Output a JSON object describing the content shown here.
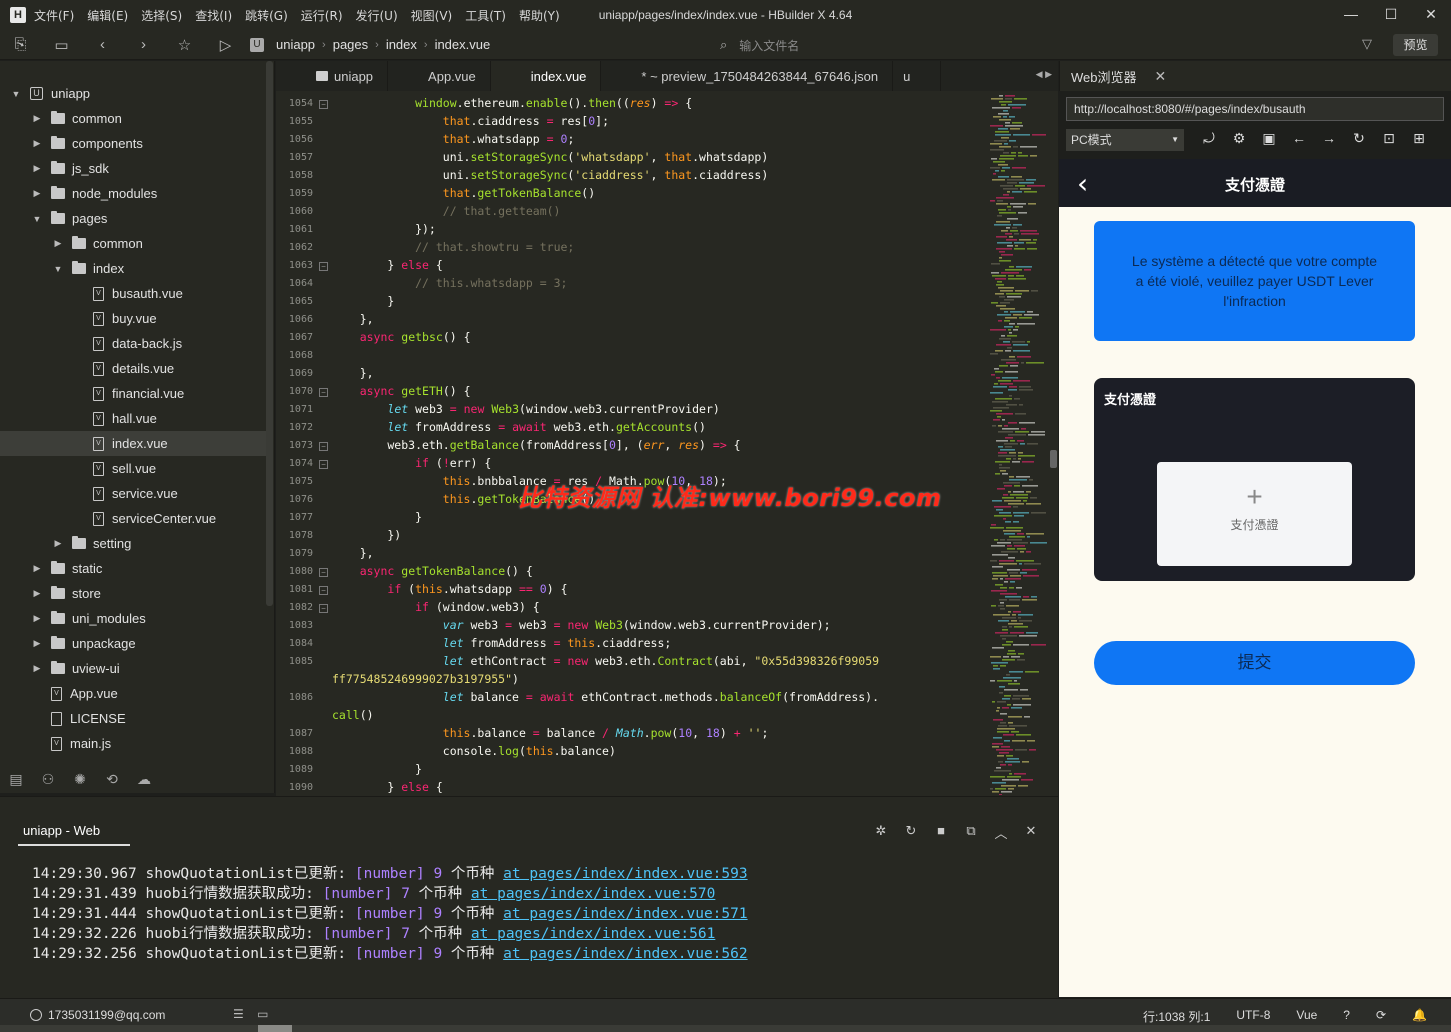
{
  "window": {
    "title": "uniapp/pages/index/index.vue - HBuilder X 4.64",
    "logo": "H",
    "menu": [
      "文件(F)",
      "编辑(E)",
      "选择(S)",
      "查找(I)",
      "跳转(G)",
      "运行(R)",
      "发行(U)",
      "视图(V)",
      "工具(T)",
      "帮助(Y)"
    ]
  },
  "toolbar": {
    "breadcrumb": [
      "uniapp",
      "pages",
      "index",
      "index.vue"
    ],
    "search_placeholder": "输入文件名",
    "preview_label": "预览"
  },
  "sidebar": {
    "items": [
      {
        "label": "uniapp",
        "depth": 0,
        "kind": "project",
        "open": true
      },
      {
        "label": "common",
        "depth": 1,
        "kind": "folder"
      },
      {
        "label": "components",
        "depth": 1,
        "kind": "folder"
      },
      {
        "label": "js_sdk",
        "depth": 1,
        "kind": "folder"
      },
      {
        "label": "node_modules",
        "depth": 1,
        "kind": "folder"
      },
      {
        "label": "pages",
        "depth": 1,
        "kind": "folder",
        "open": true
      },
      {
        "label": "common",
        "depth": 2,
        "kind": "folder"
      },
      {
        "label": "index",
        "depth": 2,
        "kind": "folder",
        "open": true
      },
      {
        "label": "busauth.vue",
        "depth": 3,
        "kind": "file"
      },
      {
        "label": "buy.vue",
        "depth": 3,
        "kind": "file"
      },
      {
        "label": "data-back.js",
        "depth": 3,
        "kind": "file"
      },
      {
        "label": "details.vue",
        "depth": 3,
        "kind": "file"
      },
      {
        "label": "financial.vue",
        "depth": 3,
        "kind": "file"
      },
      {
        "label": "hall.vue",
        "depth": 3,
        "kind": "file"
      },
      {
        "label": "index.vue",
        "depth": 3,
        "kind": "file",
        "selected": true
      },
      {
        "label": "sell.vue",
        "depth": 3,
        "kind": "file"
      },
      {
        "label": "service.vue",
        "depth": 3,
        "kind": "file"
      },
      {
        "label": "serviceCenter.vue",
        "depth": 3,
        "kind": "file"
      },
      {
        "label": "setting",
        "depth": 2,
        "kind": "folder"
      },
      {
        "label": "static",
        "depth": 1,
        "kind": "folder"
      },
      {
        "label": "store",
        "depth": 1,
        "kind": "folder"
      },
      {
        "label": "uni_modules",
        "depth": 1,
        "kind": "folder"
      },
      {
        "label": "unpackage",
        "depth": 1,
        "kind": "folder"
      },
      {
        "label": "uview-ui",
        "depth": 1,
        "kind": "folder"
      },
      {
        "label": "App.vue",
        "depth": 1,
        "kind": "file"
      },
      {
        "label": "LICENSE",
        "depth": 1,
        "kind": "plain"
      },
      {
        "label": "main.js",
        "depth": 1,
        "kind": "file"
      }
    ]
  },
  "tabs": [
    {
      "label": "uniapp",
      "folder": true
    },
    {
      "label": "App.vue"
    },
    {
      "label": "index.vue",
      "active": true
    },
    {
      "label": "* ~ preview_1750484263844_67646.json"
    },
    {
      "label": "u"
    }
  ],
  "editor": {
    "lines": [
      {
        "n": "1054",
        "html": "            <span class='fn'>window</span>.ethereum.<span class='fn'>enable</span>().<span class='fn'>then</span>((<span class='pr'>res</span>) <span class='kw'>=&gt;</span> {"
      },
      {
        "n": "1055",
        "html": "                <span class='th'>that</span>.ciaddress <span class='kw'>=</span> res[<span class='num'>0</span>];"
      },
      {
        "n": "1056",
        "html": "                <span class='th'>that</span>.whatsdapp <span class='kw'>=</span> <span class='num'>0</span>;"
      },
      {
        "n": "1057",
        "html": "                uni.<span class='fn'>setStorageSync</span>(<span class='str'>'whatsdapp'</span>, <span class='th'>that</span>.whatsdapp)"
      },
      {
        "n": "1058",
        "html": "                uni.<span class='fn'>setStorageSync</span>(<span class='str'>'ciaddress'</span>, <span class='th'>that</span>.ciaddress)"
      },
      {
        "n": "1059",
        "html": "                <span class='th'>that</span>.<span class='fn'>getTokenBalance</span>()"
      },
      {
        "n": "1060",
        "html": "                <span class='cm'>// that.getteam()</span>"
      },
      {
        "n": "1061",
        "html": "            });"
      },
      {
        "n": "1062",
        "html": "            <span class='cm'>// that.showtru = true;</span>"
      },
      {
        "n": "1063",
        "html": "        } <span class='kw'>else</span> {"
      },
      {
        "n": "1064",
        "html": "            <span class='cm'>// this.whatsdapp = 3;</span>"
      },
      {
        "n": "1065",
        "html": "        }"
      },
      {
        "n": "1066",
        "html": "    },"
      },
      {
        "n": "1067",
        "html": "    <span class='kw'>async</span> <span class='fn'>getbsc</span>() {"
      },
      {
        "n": "1068",
        "html": ""
      },
      {
        "n": "1069",
        "html": "    },"
      },
      {
        "n": "1070",
        "html": "    <span class='kw'>async</span> <span class='fn'>getETH</span>() {"
      },
      {
        "n": "1071",
        "html": "        <span class='pl'>let</span> web3 <span class='kw'>=</span> <span class='kw'>new</span> <span class='fn'>Web3</span>(window.web3.currentProvider)"
      },
      {
        "n": "1072",
        "html": "        <span class='pl'>let</span> fromAddress <span class='kw'>=</span> <span class='kw'>await</span> web3.eth.<span class='fn'>getAccounts</span>()"
      },
      {
        "n": "1073",
        "html": "        web3.eth.<span class='fn'>getBalance</span>(fromAddress[<span class='num'>0</span>], (<span class='pr'>err</span>, <span class='pr'>res</span>) <span class='kw'>=&gt;</span> {"
      },
      {
        "n": "1074",
        "html": "            <span class='kw'>if</span> (<span class='kw'>!</span>err) {"
      },
      {
        "n": "1075",
        "html": "                <span class='th'>this</span>.bnbbalance <span class='kw'>=</span> res <span class='kw'>/</span> Math.<span class='fn'>pow</span>(<span class='num'>10</span>, <span class='num'>18</span>);"
      },
      {
        "n": "1076",
        "html": "                <span class='th'>this</span>.<span class='fn'>getTokenBalance</span>()"
      },
      {
        "n": "1077",
        "html": "            }"
      },
      {
        "n": "1078",
        "html": "        })"
      },
      {
        "n": "1079",
        "html": "    },"
      },
      {
        "n": "1080",
        "html": "    <span class='kw'>async</span> <span class='fn'>getTokenBalance</span>() {"
      },
      {
        "n": "1081",
        "html": "        <span class='kw'>if</span> (<span class='th'>this</span>.whatsdapp <span class='kw'>==</span> <span class='num'>0</span>) {"
      },
      {
        "n": "1082",
        "html": "            <span class='kw'>if</span> (window.web3) {"
      },
      {
        "n": "1083",
        "html": "                <span class='pl'>var</span> web3 <span class='kw'>=</span> web3 <span class='kw'>=</span> <span class='kw'>new</span> <span class='fn'>Web3</span>(window.web3.currentProvider);"
      },
      {
        "n": "1084",
        "html": "                <span class='pl'>let</span> fromAddress <span class='kw'>=</span> <span class='th'>this</span>.ciaddress;"
      },
      {
        "n": "1085",
        "html": "                <span class='pl'>let</span> ethContract <span class='kw'>=</span> <span class='kw'>new</span> web3.eth.<span class='fn'>Contract</span>(abi, <span class='str'>\"0x55d398326f99059</span>"
      },
      {
        "n": "",
        "html": "<span class='str'>ff775485246999027b3197955\"</span>)",
        "wrap": true
      },
      {
        "n": "1086",
        "html": "                <span class='pl'>let</span> balance <span class='kw'>=</span> <span class='kw'>await</span> ethContract.methods.<span class='fn'>balanceOf</span>(fromAddress)."
      },
      {
        "n": "",
        "html": "<span class='fn'>call</span>()",
        "wrap": true
      },
      {
        "n": "1087",
        "html": "                <span class='th'>this</span>.balance <span class='kw'>=</span> balance <span class='kw'>/</span> <span class='pl'>Math</span>.<span class='fn'>pow</span>(<span class='num'>10</span>, <span class='num'>18</span>) <span class='kw'>+</span> <span class='str'>''</span>;"
      },
      {
        "n": "1088",
        "html": "                console.<span class='fn'>log</span>(<span class='th'>this</span>.balance)"
      },
      {
        "n": "1089",
        "html": "            }"
      },
      {
        "n": "1090",
        "html": "        } <span class='kw'>else</span> {"
      }
    ],
    "folds": [
      "1054",
      "1063",
      "1070",
      "1073",
      "1074",
      "1080",
      "1081",
      "1082"
    ],
    "watermark": "比特资源网 认准:www.bori99.com"
  },
  "web_panel": {
    "tab_label": "Web浏览器",
    "url": "http://localhost:8080/#/pages/index/busauth",
    "mode": "PC模式",
    "page": {
      "nav_title": "支付憑證",
      "alert_text": "Le système a détecté que votre compte a été violé, veuillez payer USDT Lever l'infraction",
      "card_title": "支付憑證",
      "upload_label": "支付憑證",
      "submit_label": "提交"
    }
  },
  "console": {
    "tab_label": "uniapp - Web",
    "logs": [
      {
        "time": "14:29:30.967",
        "msg": "showQuotationList已更新:",
        "type": "[number]",
        "count": "9",
        "unit": "个币种",
        "link": "at pages/index/index.vue:593"
      },
      {
        "time": "14:29:31.439",
        "msg": "huobi行情数据获取成功:",
        "type": "[number]",
        "count": "7",
        "unit": "个币种",
        "link": "at pages/index/index.vue:570"
      },
      {
        "time": "14:29:31.444",
        "msg": "showQuotationList已更新:",
        "type": "[number]",
        "count": "9",
        "unit": "个币种",
        "link": "at pages/index/index.vue:571"
      },
      {
        "time": "14:29:32.226",
        "msg": "huobi行情数据获取成功:",
        "type": "[number]",
        "count": "7",
        "unit": "个币种",
        "link": "at pages/index/index.vue:561"
      },
      {
        "time": "14:29:32.256",
        "msg": "showQuotationList已更新:",
        "type": "[number]",
        "count": "9",
        "unit": "个币种",
        "link": "at pages/index/index.vue:562"
      }
    ]
  },
  "status": {
    "user": "1735031199@qq.com",
    "position": "行:1038  列:1",
    "encoding": "UTF-8",
    "language": "Vue"
  }
}
